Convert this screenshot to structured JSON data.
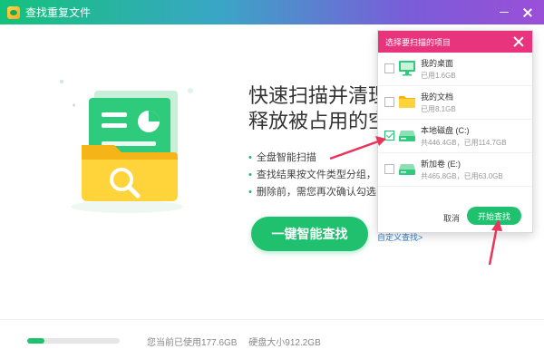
{
  "window": {
    "title": "查找重复文件",
    "minimize_icon": "minimize-icon",
    "close_icon": "close-icon"
  },
  "colors": {
    "accent": "#1fc16f",
    "popup_header": "#e8337d",
    "annotation_arrow": "#e8355b",
    "link": "#2a7fd4"
  },
  "hero": {
    "illustration_icon": "folder-search-illustration",
    "headline_line1": "快速扫描并清理重",
    "headline_line2": "释放被占用的空",
    "features": [
      "全盘智能扫描",
      "查找结果按文件类型分组，",
      "删除前，需您再次确认勾选"
    ],
    "scan_button": "一键智能查找",
    "custom_scan_link": "自定义查找>"
  },
  "footer": {
    "used_text": "您当前已使用177.6GB",
    "disk_text": "硬盘大小912.2GB",
    "usage_fraction": 0.19
  },
  "popup": {
    "title": "选择要扫描的项目",
    "items": [
      {
        "name": "我的桌面",
        "sub": "已用1.6GB",
        "icon": "desktop-monitor-icon",
        "checked": false
      },
      {
        "name": "我的文档",
        "sub": "已用8.1GB",
        "icon": "folder-icon",
        "checked": false
      },
      {
        "name": "本地磁盘 (C:)",
        "sub": "共446.4GB，已用114.7GB",
        "icon": "hard-drive-icon",
        "checked": true
      },
      {
        "name": "新加卷 (E:)",
        "sub": "共465.8GB，已用63.0GB",
        "icon": "hard-drive-icon",
        "checked": false
      }
    ],
    "cancel_label": "取消",
    "start_label": "开始查找"
  }
}
